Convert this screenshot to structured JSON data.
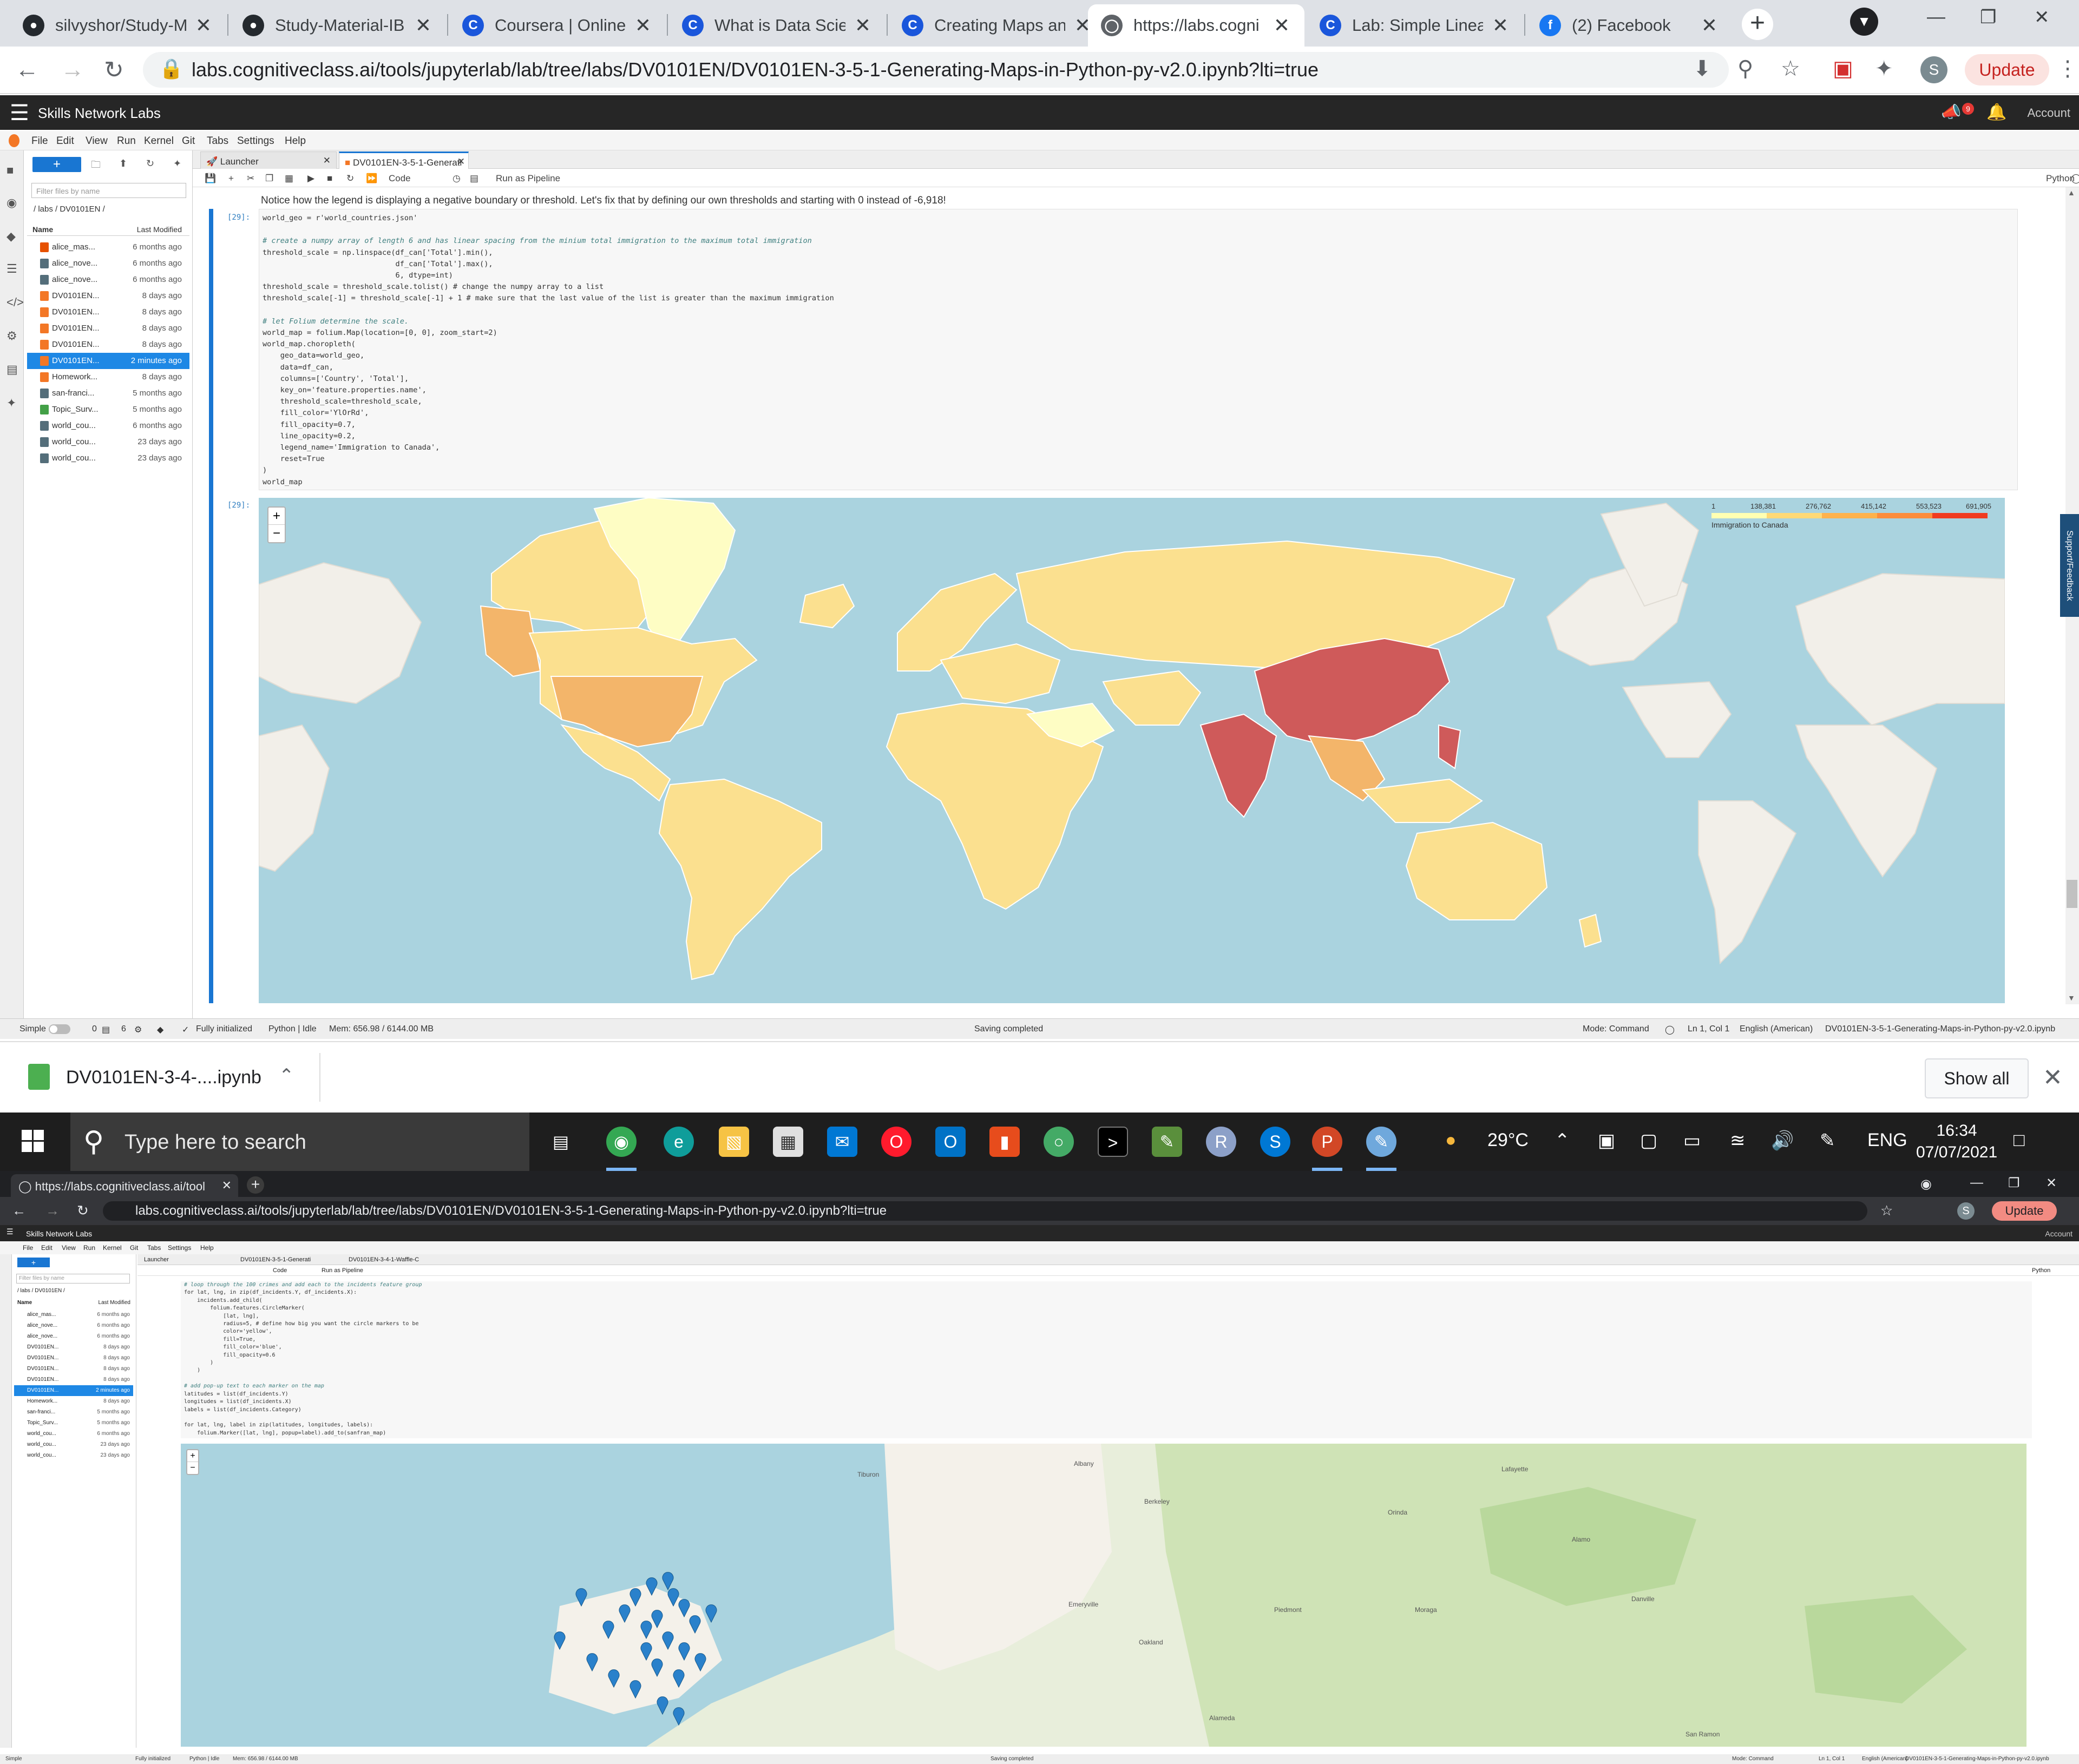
{
  "browser_tabs": [
    {
      "title": "silvyshor/Study-M",
      "icon": "github-icon",
      "color": "#24292e"
    },
    {
      "title": "Study-Material-IB",
      "icon": "github-icon",
      "color": "#24292e"
    },
    {
      "title": "Coursera | Online",
      "icon": "coursera-icon",
      "color": "#1a56db"
    },
    {
      "title": "What is Data Scien",
      "icon": "coursera-icon",
      "color": "#1a56db"
    },
    {
      "title": "Creating Maps an",
      "icon": "coursera-icon",
      "color": "#1a56db"
    },
    {
      "title": "https://labs.cogni",
      "icon": "globe-icon",
      "color": "#5f6368"
    },
    {
      "title": "Lab: Simple Linea",
      "icon": "coursera-icon",
      "color": "#1a56db"
    },
    {
      "title": "(2) Facebook",
      "icon": "facebook-icon",
      "color": "#1877f2"
    }
  ],
  "address": {
    "url": "labs.cognitiveclass.ai/tools/jupyterlab/lab/tree/labs/DV0101EN/DV0101EN-3-5-1-Generating-Maps-in-Python-py-v2.0.ipynb?lti=true",
    "update_label": "Update",
    "profile_initial": "S"
  },
  "jupyter": {
    "brand": "Skills Network Labs",
    "account_label": "Account",
    "notification_count": "9",
    "menu": [
      "File",
      "Edit",
      "View",
      "Run",
      "Kernel",
      "Git",
      "Tabs",
      "Settings",
      "Help"
    ],
    "filebrowser": {
      "filter_placeholder": "Filter files by name",
      "breadcrumb": "/ labs / DV0101EN /",
      "col_name": "Name",
      "col_modified": "Last Modified",
      "files": [
        {
          "name": "alice_mas...",
          "modified": "6 months ago",
          "kind": "image"
        },
        {
          "name": "alice_nove...",
          "modified": "6 months ago",
          "kind": "file"
        },
        {
          "name": "alice_nove...",
          "modified": "6 months ago",
          "kind": "file"
        },
        {
          "name": "DV0101EN...",
          "modified": "8 days ago",
          "kind": "notebook"
        },
        {
          "name": "DV0101EN...",
          "modified": "8 days ago",
          "kind": "notebook"
        },
        {
          "name": "DV0101EN...",
          "modified": "8 days ago",
          "kind": "notebook"
        },
        {
          "name": "DV0101EN...",
          "modified": "8 days ago",
          "kind": "notebook"
        },
        {
          "name": "DV0101EN...",
          "modified": "2 minutes ago",
          "kind": "notebook",
          "selected": true
        },
        {
          "name": "Homework...",
          "modified": "8 days ago",
          "kind": "notebook"
        },
        {
          "name": "san-franci...",
          "modified": "5 months ago",
          "kind": "file"
        },
        {
          "name": "Topic_Surv...",
          "modified": "5 months ago",
          "kind": "sheet"
        },
        {
          "name": "world_cou...",
          "modified": "6 months ago",
          "kind": "file"
        },
        {
          "name": "world_cou...",
          "modified": "23 days ago",
          "kind": "file"
        },
        {
          "name": "world_cou...",
          "modified": "23 days ago",
          "kind": "file"
        }
      ]
    },
    "doc_tabs": [
      {
        "label": "Launcher"
      },
      {
        "label": "DV0101EN-3-5-1-Generati"
      }
    ],
    "toolbar": {
      "cell_type": "Code",
      "run_pipeline": "Run as Pipeline",
      "kernel": "Python"
    },
    "markdown_text": "Notice how the legend is displaying a negative boundary or threshold. Let's fix that by defining our own thresholds and starting with 0 instead of -6,918!",
    "input_prompt": "[29]:",
    "output_prompt": "[29]:",
    "code_lines": [
      "world_geo = r'world_countries.json'",
      "",
      "# create a numpy array of length 6 and has linear spacing from the minium total immigration to the maximum total immigration",
      "threshold_scale = np.linspace(df_can['Total'].min(),",
      "                              df_can['Total'].max(),",
      "                              6, dtype=int)",
      "threshold_scale = threshold_scale.tolist() # change the numpy array to a list",
      "threshold_scale[-1] = threshold_scale[-1] + 1 # make sure that the last value of the list is greater than the maximum immigration",
      "",
      "# let Folium determine the scale.",
      "world_map = folium.Map(location=[0, 0], zoom_start=2)",
      "world_map.choropleth(",
      "    geo_data=world_geo,",
      "    data=df_can,",
      "    columns=['Country', 'Total'],",
      "    key_on='feature.properties.name',",
      "    threshold_scale=threshold_scale,",
      "    fill_color='YlOrRd',",
      "    fill_opacity=0.7,",
      "    line_opacity=0.2,",
      "    legend_name='Immigration to Canada',",
      "    reset=True",
      ")",
      "world_map"
    ],
    "map": {
      "zoom_in": "+",
      "zoom_out": "−",
      "legend_ticks": [
        "1",
        "138,381",
        "276,762",
        "415,142",
        "553,523",
        "691,905"
      ],
      "legend_colors": [
        "#ffffb2",
        "#fed976",
        "#feb24c",
        "#fd8d3c",
        "#f03b20",
        "#bd0026"
      ],
      "legend_caption": "Immigration to Canada",
      "colors": {
        "ocean": "#aad3df",
        "land": "#f2efe9",
        "low": "#fbe08f",
        "mid": "#f3b56a",
        "high": "#cf5a5a",
        "pale": "#fefdc4"
      }
    },
    "support_label": "Support/Feedback",
    "status": {
      "mode": "Simple",
      "counts": [
        "0",
        "6"
      ],
      "init": "Fully initialized",
      "kernel": "Python | Idle",
      "mem": "Mem: 656.98 / 6144.00 MB",
      "saving": "Saving completed",
      "cmd_mode": "Mode: Command",
      "pos": "Ln 1, Col 1",
      "lang": "English (American)",
      "file": "DV0101EN-3-5-1-Generating-Maps-in-Python-py-v2.0.ipynb"
    }
  },
  "download": {
    "file": "DV0101EN-3-4-....ipynb",
    "show_all": "Show all"
  },
  "taskbar": {
    "search_placeholder": "Type here to search",
    "temperature": "29°C",
    "lang": "ENG",
    "time": "16:34",
    "date": "07/07/2021"
  },
  "lower": {
    "tab_title": "https://labs.cognitiveclass.ai/tool",
    "url": "labs.cognitiveclass.ai/tools/jupyterlab/lab/tree/labs/DV0101EN/DV0101EN-3-5-1-Generating-Maps-in-Python-py-v2.0.ipynb?lti=true",
    "update_label": "Update",
    "doc_tabs": [
      "Launcher",
      "DV0101EN-3-5-1-Generati",
      "DV0101EN-3-4-1-Waffle-C"
    ],
    "code_lines": [
      "# loop through the 100 crimes and add each to the incidents feature group",
      "for lat, lng, in zip(df_incidents.Y, df_incidents.X):",
      "    incidents.add_child(",
      "        folium.features.CircleMarker(",
      "            [lat, lng],",
      "            radius=5, # define how big you want the circle markers to be",
      "            color='yellow',",
      "            fill=True,",
      "            fill_color='blue',",
      "            fill_opacity=0.6",
      "        )",
      "    )",
      "",
      "# add pop-up text to each marker on the map",
      "latitudes = list(df_incidents.Y)",
      "longitudes = list(df_incidents.X)",
      "labels = list(df_incidents.Category)",
      "",
      "for lat, lng, label in zip(latitudes, longitudes, labels):",
      "    folium.Marker([lat, lng], popup=label).add_to(sanfran_map)",
      "",
      "# add incidents to map",
      "sanfran_map.add_child(incidents)"
    ],
    "map_labels": [
      "Tiburon",
      "Albany",
      "Berkeley",
      "Lafayette",
      "Orinda",
      "Moraga",
      "Piedmont",
      "Oakland",
      "Alameda",
      "Danville",
      "San Ramon",
      "Emeryville",
      "Alamo"
    ],
    "status": {
      "init": "Fully initialized",
      "kernel": "Python | Idle",
      "mem": "Mem: 656.98 / 6144.00 MB",
      "saving": "Saving completed",
      "cmd_mode": "Mode: Command",
      "pos": "Ln 1, Col 1",
      "lang": "English (American)",
      "file": "DV0101EN-3-5-1-Generating-Maps-in-Python-py-v2.0.ipynb"
    }
  }
}
